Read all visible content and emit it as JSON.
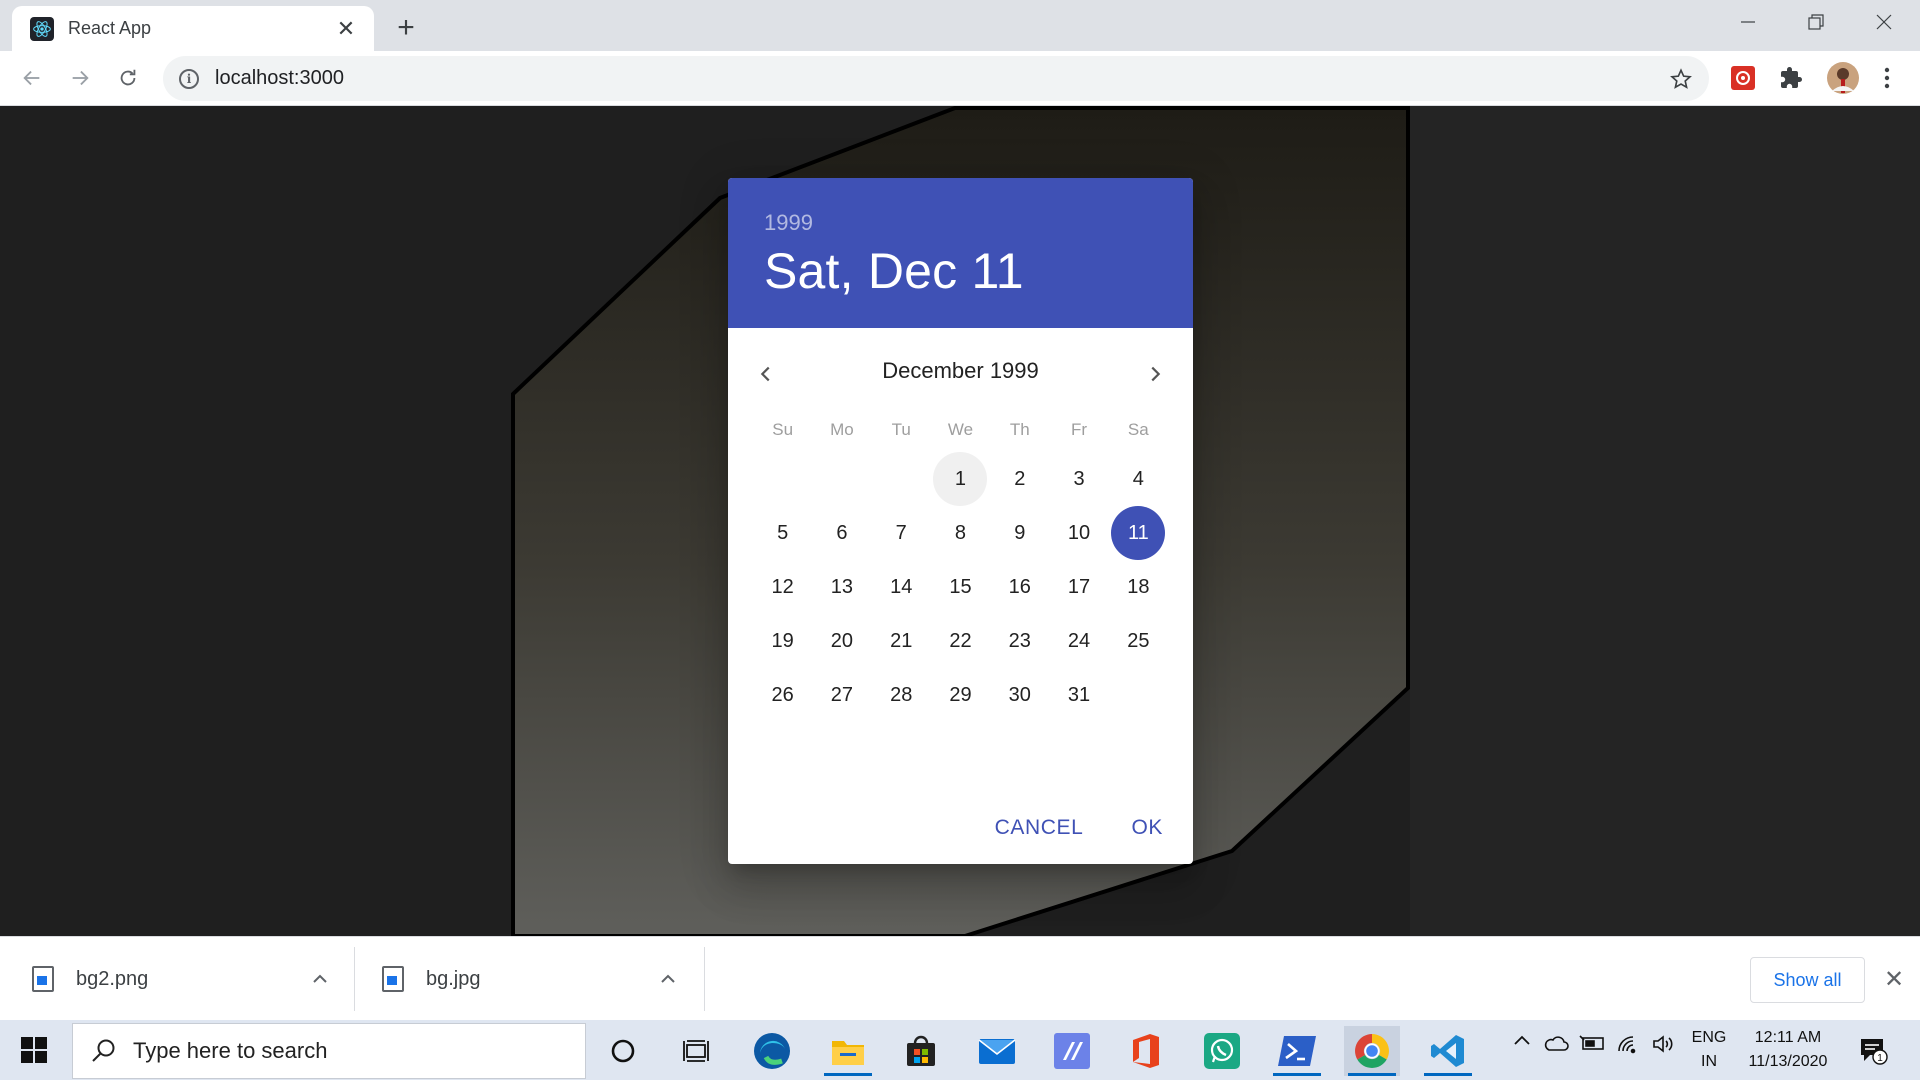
{
  "browser": {
    "tab": {
      "title": "React App",
      "favicon": "react-icon",
      "close_label": "✕"
    },
    "new_tab_label": "+",
    "url": "localhost:3000",
    "window_controls": {
      "minimize": "—",
      "restore": "❐",
      "close": "✕"
    }
  },
  "datepicker": {
    "header": {
      "year": "1999",
      "date": "Sat, Dec 11"
    },
    "month_label": "December 1999",
    "weekdays": [
      "Su",
      "Mo",
      "Tu",
      "We",
      "Th",
      "Fr",
      "Sa"
    ],
    "weeks": [
      [
        "",
        "",
        "",
        "1",
        "2",
        "3",
        "4"
      ],
      [
        "5",
        "6",
        "7",
        "8",
        "9",
        "10",
        "11"
      ],
      [
        "12",
        "13",
        "14",
        "15",
        "16",
        "17",
        "18"
      ],
      [
        "19",
        "20",
        "21",
        "22",
        "23",
        "24",
        "25"
      ],
      [
        "26",
        "27",
        "28",
        "29",
        "30",
        "31",
        ""
      ]
    ],
    "today": "1",
    "selected": "11",
    "actions": {
      "cancel": "CANCEL",
      "ok": "OK"
    },
    "accent_color": "#3f51b5"
  },
  "downloads": {
    "items": [
      {
        "name": "bg2.png",
        "icon": "image-file-icon"
      },
      {
        "name": "bg.jpg",
        "icon": "image-file-icon"
      }
    ],
    "show_all": "Show all",
    "close_label": "✕"
  },
  "taskbar": {
    "search_placeholder": "Type here to search",
    "language": {
      "line1": "ENG",
      "line2": "IN"
    },
    "clock": {
      "time": "12:11 AM",
      "date": "11/13/2020"
    },
    "notification_count": "1",
    "apps": [
      "cortana-icon",
      "task-view-icon",
      "edge-icon",
      "file-explorer-icon",
      "store-icon",
      "mail-icon",
      "vpn-app-icon",
      "office-icon",
      "whatsapp-icon",
      "powershell-icon",
      "chrome-icon",
      "vscode-icon"
    ]
  }
}
